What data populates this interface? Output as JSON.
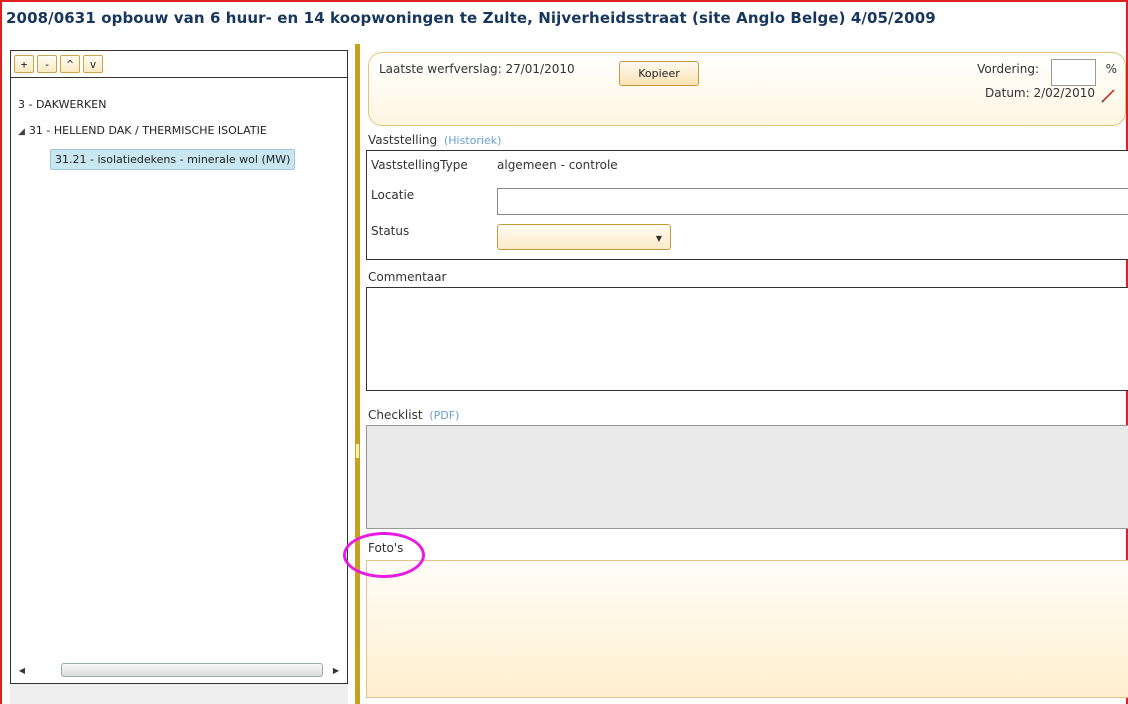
{
  "header": {
    "title": "2008/0631 opbouw van 6 huur- en 14 koopwoningen te Zulte, Nijverheidsstraat (site Anglo Belge) 4/05/2009"
  },
  "tree_toolbar": {
    "buttons": [
      "+",
      "-",
      "^",
      "v"
    ]
  },
  "tree": {
    "root": "3 - DAKWERKEN",
    "group": "31 - HELLEND DAK / THERMISCHE ISOLATIE",
    "group_arrow": "◢",
    "leaf": "31.21 - isolatiedekens - minerale wol (MW)"
  },
  "scrollbar": {
    "left_arrow": "◀",
    "right_arrow": "▶"
  },
  "top_card": {
    "laatste_label": "Laatste werfverslag: 27/01/2010",
    "kopieer_label": "Kopieer",
    "vordering_label": "Vordering:",
    "vordering_value": "",
    "pct": "%",
    "datum_label": "Datum: 2/02/2010",
    "edit_icon": "pencil-icon"
  },
  "vaststelling": {
    "header": "Vaststelling",
    "link": "(Historiek)",
    "type_label": "VaststellingType",
    "type_value": "algemeen - controle",
    "locatie_label": "Locatie",
    "locatie_value": "",
    "status_label": "Status",
    "status_value": "",
    "status_chevron": "▼"
  },
  "commentaar": {
    "header": "Commentaar"
  },
  "checklist": {
    "header": "Checklist",
    "link": "(PDF)"
  },
  "fotos": {
    "header": "Foto's"
  },
  "colors": {
    "title": "#17375e",
    "accent": "#c8a020",
    "frame": "#e02020",
    "annotation": "#e81ce0",
    "link": "#6a9fd4"
  }
}
